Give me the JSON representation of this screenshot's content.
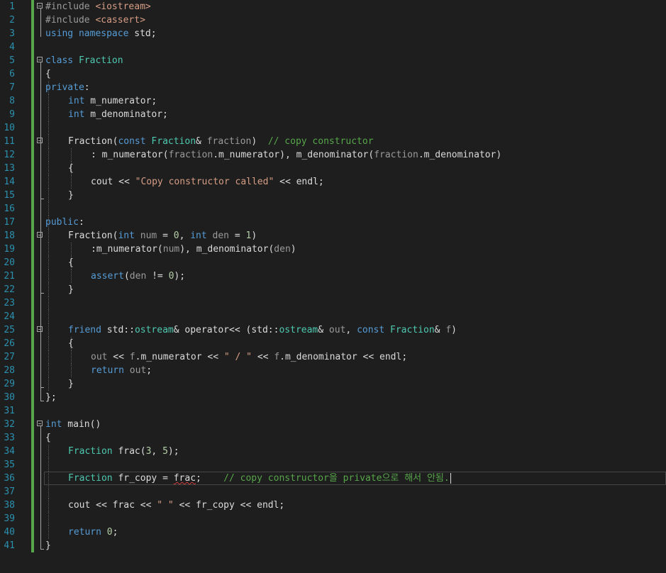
{
  "colors": {
    "background": "#1e1e1e",
    "line_number": "#2b91af",
    "change_bar": "#57a64a",
    "keyword": "#569cd6",
    "type": "#4ec9b0",
    "string": "#d69d85",
    "comment": "#57a64a",
    "number": "#b5cea8",
    "parameter": "#9a9a9a",
    "member": "#dadada",
    "preprocessor": "#9b9b9b",
    "include_path": "#d69d85",
    "default": "#dcdcdc"
  },
  "current_line": 36,
  "lines": [
    {
      "n": "1",
      "fold": "start",
      "indent": 0,
      "tokens": [
        {
          "t": "#include ",
          "c": "preprocessor"
        },
        {
          "t": "<iostream>",
          "c": "include_path"
        }
      ]
    },
    {
      "n": "2",
      "indent": 0,
      "tokens": [
        {
          "t": "#include ",
          "c": "preprocessor"
        },
        {
          "t": "<cassert>",
          "c": "include_path"
        }
      ]
    },
    {
      "n": "3",
      "indent": 0,
      "tokens": [
        {
          "t": "using",
          "c": "keyword"
        },
        {
          "t": " ",
          "c": "default"
        },
        {
          "t": "namespace",
          "c": "keyword"
        },
        {
          "t": " std;",
          "c": "default"
        }
      ]
    },
    {
      "n": "4",
      "indent": 0,
      "tokens": []
    },
    {
      "n": "5",
      "fold": "start",
      "indent": 0,
      "tokens": [
        {
          "t": "class",
          "c": "keyword"
        },
        {
          "t": " ",
          "c": "default"
        },
        {
          "t": "Fraction",
          "c": "type"
        }
      ]
    },
    {
      "n": "6",
      "indent": 0,
      "tokens": [
        {
          "t": "{",
          "c": "default"
        }
      ]
    },
    {
      "n": "7",
      "indent": 0,
      "tokens": [
        {
          "t": "private",
          "c": "keyword"
        },
        {
          "t": ":",
          "c": "default"
        }
      ]
    },
    {
      "n": "8",
      "indent": 1,
      "tokens": [
        {
          "t": "int",
          "c": "keyword"
        },
        {
          "t": " m_numerator;",
          "c": "member"
        }
      ]
    },
    {
      "n": "9",
      "indent": 1,
      "tokens": [
        {
          "t": "int",
          "c": "keyword"
        },
        {
          "t": " m_denominator;",
          "c": "member"
        }
      ]
    },
    {
      "n": "10",
      "indent": 0,
      "tokens": []
    },
    {
      "n": "11",
      "fold": "start",
      "indent": 1,
      "tokens": [
        {
          "t": "Fraction",
          "c": "default"
        },
        {
          "t": "(",
          "c": "default"
        },
        {
          "t": "const",
          "c": "keyword"
        },
        {
          "t": " ",
          "c": "default"
        },
        {
          "t": "Fraction",
          "c": "type"
        },
        {
          "t": "& ",
          "c": "default"
        },
        {
          "t": "fraction",
          "c": "parameter"
        },
        {
          "t": ")  ",
          "c": "default"
        },
        {
          "t": "// copy constructor",
          "c": "comment"
        }
      ]
    },
    {
      "n": "12",
      "indent": 2,
      "tokens": [
        {
          "t": ": m_numerator(",
          "c": "member"
        },
        {
          "t": "fraction",
          "c": "parameter"
        },
        {
          "t": ".m_numerator), m_denominator(",
          "c": "member"
        },
        {
          "t": "fraction",
          "c": "parameter"
        },
        {
          "t": ".m_denominator)",
          "c": "member"
        }
      ]
    },
    {
      "n": "13",
      "indent": 1,
      "tokens": [
        {
          "t": "{",
          "c": "default"
        }
      ]
    },
    {
      "n": "14",
      "indent": 2,
      "tokens": [
        {
          "t": "cout << ",
          "c": "default"
        },
        {
          "t": "\"Copy constructor called\"",
          "c": "string"
        },
        {
          "t": " << endl;",
          "c": "default"
        }
      ]
    },
    {
      "n": "15",
      "indent": 1,
      "tokens": [
        {
          "t": "}",
          "c": "default"
        }
      ]
    },
    {
      "n": "16",
      "indent": 0,
      "tokens": []
    },
    {
      "n": "17",
      "indent": 0,
      "tokens": [
        {
          "t": "public",
          "c": "keyword"
        },
        {
          "t": ":",
          "c": "default"
        }
      ]
    },
    {
      "n": "18",
      "fold": "start",
      "indent": 1,
      "tokens": [
        {
          "t": "Fraction(",
          "c": "default"
        },
        {
          "t": "int",
          "c": "keyword"
        },
        {
          "t": " ",
          "c": "default"
        },
        {
          "t": "num",
          "c": "parameter"
        },
        {
          "t": " = ",
          "c": "default"
        },
        {
          "t": "0",
          "c": "number"
        },
        {
          "t": ", ",
          "c": "default"
        },
        {
          "t": "int",
          "c": "keyword"
        },
        {
          "t": " ",
          "c": "default"
        },
        {
          "t": "den",
          "c": "parameter"
        },
        {
          "t": " = ",
          "c": "default"
        },
        {
          "t": "1",
          "c": "number"
        },
        {
          "t": ")",
          "c": "default"
        }
      ]
    },
    {
      "n": "19",
      "indent": 2,
      "tokens": [
        {
          "t": ":m_numerator(",
          "c": "member"
        },
        {
          "t": "num",
          "c": "parameter"
        },
        {
          "t": "), m_denominator(",
          "c": "member"
        },
        {
          "t": "den",
          "c": "parameter"
        },
        {
          "t": ")",
          "c": "member"
        }
      ]
    },
    {
      "n": "20",
      "indent": 1,
      "tokens": [
        {
          "t": "{",
          "c": "default"
        }
      ]
    },
    {
      "n": "21",
      "indent": 2,
      "tokens": [
        {
          "t": "assert",
          "c": "keyword"
        },
        {
          "t": "(",
          "c": "default"
        },
        {
          "t": "den",
          "c": "parameter"
        },
        {
          "t": " != ",
          "c": "default"
        },
        {
          "t": "0",
          "c": "number"
        },
        {
          "t": ");",
          "c": "default"
        }
      ]
    },
    {
      "n": "22",
      "indent": 1,
      "tokens": [
        {
          "t": "}",
          "c": "default"
        }
      ]
    },
    {
      "n": "23",
      "indent": 0,
      "tokens": []
    },
    {
      "n": "24",
      "indent": 0,
      "tokens": []
    },
    {
      "n": "25",
      "fold": "start",
      "indent": 1,
      "tokens": [
        {
          "t": "friend",
          "c": "keyword"
        },
        {
          "t": " std::",
          "c": "default"
        },
        {
          "t": "ostream",
          "c": "type"
        },
        {
          "t": "& ",
          "c": "default"
        },
        {
          "t": "operator<<",
          "c": "default"
        },
        {
          "t": " (std::",
          "c": "default"
        },
        {
          "t": "ostream",
          "c": "type"
        },
        {
          "t": "& ",
          "c": "default"
        },
        {
          "t": "out",
          "c": "parameter"
        },
        {
          "t": ", ",
          "c": "default"
        },
        {
          "t": "const",
          "c": "keyword"
        },
        {
          "t": " ",
          "c": "default"
        },
        {
          "t": "Fraction",
          "c": "type"
        },
        {
          "t": "& ",
          "c": "default"
        },
        {
          "t": "f",
          "c": "parameter"
        },
        {
          "t": ")",
          "c": "default"
        }
      ]
    },
    {
      "n": "26",
      "indent": 1,
      "tokens": [
        {
          "t": "{",
          "c": "default"
        }
      ]
    },
    {
      "n": "27",
      "indent": 2,
      "tokens": [
        {
          "t": "out",
          "c": "parameter"
        },
        {
          "t": " << ",
          "c": "default"
        },
        {
          "t": "f",
          "c": "parameter"
        },
        {
          "t": ".m_numerator << ",
          "c": "member"
        },
        {
          "t": "\" / \"",
          "c": "string"
        },
        {
          "t": " << ",
          "c": "default"
        },
        {
          "t": "f",
          "c": "parameter"
        },
        {
          "t": ".m_denominator << endl;",
          "c": "member"
        }
      ]
    },
    {
      "n": "28",
      "indent": 2,
      "tokens": [
        {
          "t": "return",
          "c": "keyword"
        },
        {
          "t": " ",
          "c": "default"
        },
        {
          "t": "out",
          "c": "parameter"
        },
        {
          "t": ";",
          "c": "default"
        }
      ]
    },
    {
      "n": "29",
      "indent": 1,
      "tokens": [
        {
          "t": "}",
          "c": "default"
        }
      ]
    },
    {
      "n": "30",
      "indent": 0,
      "tokens": [
        {
          "t": "};",
          "c": "default"
        }
      ]
    },
    {
      "n": "31",
      "indent": 0,
      "tokens": []
    },
    {
      "n": "32",
      "fold": "start",
      "indent": 0,
      "tokens": [
        {
          "t": "int",
          "c": "keyword"
        },
        {
          "t": " main()",
          "c": "default"
        }
      ]
    },
    {
      "n": "33",
      "indent": 0,
      "tokens": [
        {
          "t": "{",
          "c": "default"
        }
      ]
    },
    {
      "n": "34",
      "indent": 1,
      "tokens": [
        {
          "t": "Fraction",
          "c": "type"
        },
        {
          "t": " frac(",
          "c": "default"
        },
        {
          "t": "3",
          "c": "number"
        },
        {
          "t": ", ",
          "c": "default"
        },
        {
          "t": "5",
          "c": "number"
        },
        {
          "t": ");",
          "c": "default"
        }
      ]
    },
    {
      "n": "35",
      "indent": 0,
      "tokens": []
    },
    {
      "n": "36",
      "indent": 1,
      "tokens": [
        {
          "t": "Fraction",
          "c": "type"
        },
        {
          "t": " fr_copy = ",
          "c": "default"
        },
        {
          "t": "frac",
          "c": "default",
          "squiggle": true
        },
        {
          "t": ";    ",
          "c": "default"
        },
        {
          "t": "// copy constructor을 private으로 해서 안됨.",
          "c": "comment"
        }
      ]
    },
    {
      "n": "37",
      "indent": 0,
      "tokens": []
    },
    {
      "n": "38",
      "indent": 1,
      "tokens": [
        {
          "t": "cout << frac << ",
          "c": "default"
        },
        {
          "t": "\" \"",
          "c": "string"
        },
        {
          "t": " << fr_copy << endl;",
          "c": "default"
        }
      ]
    },
    {
      "n": "39",
      "indent": 0,
      "tokens": []
    },
    {
      "n": "40",
      "indent": 1,
      "tokens": [
        {
          "t": "return",
          "c": "keyword"
        },
        {
          "t": " ",
          "c": "default"
        },
        {
          "t": "0",
          "c": "number"
        },
        {
          "t": ";",
          "c": "default"
        }
      ]
    },
    {
      "n": "41",
      "indent": 0,
      "tokens": [
        {
          "t": "}",
          "c": "default"
        }
      ]
    }
  ]
}
